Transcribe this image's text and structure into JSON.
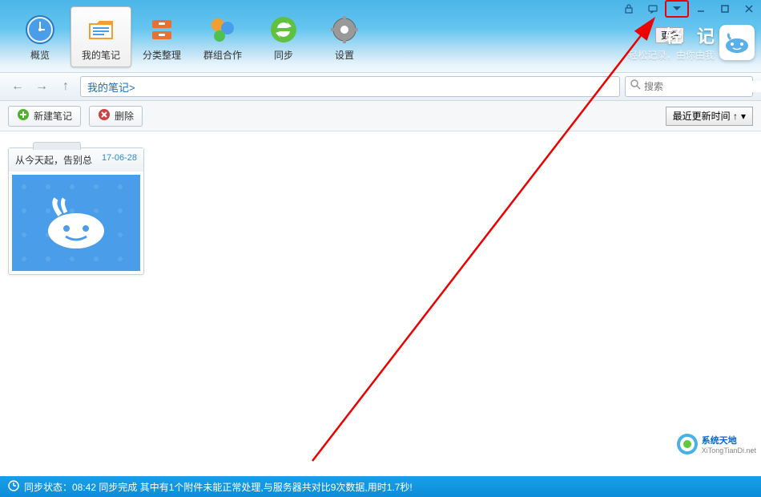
{
  "toolbar": {
    "overview": "概览",
    "my_notes": "我的笔记",
    "categories": "分类整理",
    "groups": "群组合作",
    "sync": "同步",
    "settings": "设置"
  },
  "branding": {
    "title_left": "轻",
    "title_right": "记",
    "subtitle": "轻松记录，由你由我",
    "more": "更多"
  },
  "nav": {
    "breadcrumb": "我的笔记>",
    "search_placeholder": "搜索"
  },
  "actions": {
    "new_note": "新建笔记",
    "delete": "删除",
    "sort": "最近更新时间 ↑"
  },
  "notes": [
    {
      "title": "从今天起，告别总",
      "date": "17-06-28"
    }
  ],
  "status": {
    "text": "同步状态：08:42 同步完成 其中有1个附件未能正常处理,与服务器共对比9次数据,用时1.7秒!"
  },
  "watermark": {
    "cn": "系统天地",
    "en": "XiTongTianDi.net"
  }
}
